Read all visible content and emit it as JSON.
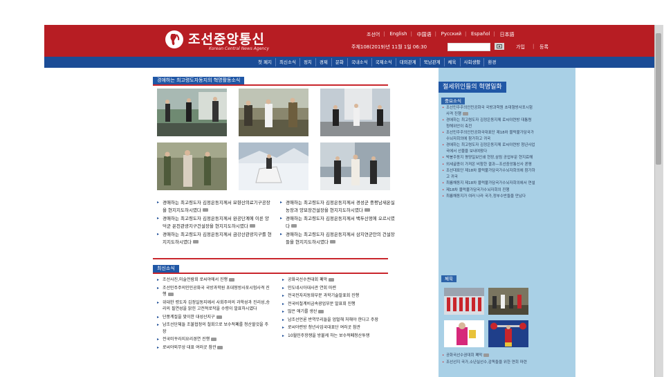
{
  "header": {
    "logo_text": "조선중앙통신",
    "logo_subtitle": "Korean Central News Agency",
    "languages": [
      "조선어",
      "English",
      "中国语",
      "Русский",
      "Español",
      "日本語"
    ],
    "date": "주체108(2019)년 11월 1일 06:30",
    "login_label": "가입",
    "register_label": "등록"
  },
  "nav": {
    "items": [
      "첫 페지",
      "최신소식",
      "정치",
      "경제",
      "문화",
      "국내소식",
      "국제소식",
      "대외관계",
      "북남관계",
      "체육",
      "사회생활",
      "환경"
    ]
  },
  "main": {
    "section_title": "경애하는 최고령도자동지의 혁명활동소식",
    "news_left": [
      "경애하는 최고령도자 김정은동지께서 묘향산의료기구공장을 현지지도하시였다",
      "경애하는 최고령도자 김정은동지께서 완공단계에 이른 양덕군 온천관광지구건설장을 현지지도하시였다",
      "경애하는 최고령도자 김정은동지께서 금강산관광지구를 현지지도하시였다"
    ],
    "news_right": [
      "경애하는 최고령도자 김정은동지께서 경성군 중평남새온실농장과 양묘장건설장을 현지지도하시였다",
      "경애하는 최고령도자 김정은동지께서 백두산정에 오르시였다",
      "경애하는 최고령도자 김정은동지께서 삼지연군안의 건설장들을 현지지도하시였다"
    ],
    "latest_title": "최신소식",
    "latest_left": [
      "조선사진,미술전람회 로씨야에서 진행",
      "조선민주주의인민공화국 국방과학원 초대형방사포시험사격 진행",
      "위대한 령도자 김정일동지께서 사회주의의 과학성과 진리성,승리의 필연성을 밝힌 고전적로작을 수령이 발표하시였다",
      "단풍계절을 맞이한 대성산지구",
      "남조선단체들 조불협정의 철회으로 보수적폐를 청산할것을 주장",
      "전국미꾸라지요리경연 진행",
      "로씨야외무상 대표 여러곳 참관"
    ],
    "latest_right": [
      "공화국선수권대회 폐막",
      "인도네시아대사관 연회 마련",
      "전국전자지동화부문 과학기술발표회 진행",
      "전국비철계비금속광업부문 발표회 진행",
      "많은 애기를 생산",
      "남조선언론 반역무리들을 엄벌해 처해야 한다고 주장",
      "로씨야련방 청년사업국대표단 여러곳 참관",
      "10월민주항쟁을 방불케 하는 보수적폐청산투쟁"
    ]
  },
  "sidebar": {
    "title": "절세위인들의 혁명일화",
    "important_title": "중요소식",
    "important_items": [
      "조선민주주의인민공화국 국방과학원 초대형방사포시험사격 진행",
      "경애하는 최고령도자 김정은동지께 로씨야련방 대통령 청해위안이 축전",
      "조선민주주의인민공화국대표단 제18차 블럭불가담국가수뇌자회의에 참가하고 귀국",
      "경애하는 최고령도자 김정은동지께 로씨야련방 청년사업국에서 선물을 보내여왔다",
      "박봉주동지 평양일보인쇄 현장,삼림 공업부문 현지료해",
      "외세굴종이 가져온 비참한 결과—조선중앙통신사 론평",
      "조선대표단 제18차 블럭불가담국가수뇌자회의에 참가하고 귀국",
      "최룡해동지 제18차 블럭불가담국가수뇌자회의에서 연설",
      "제18차 블럭불가담국가수뇌자회의 진행",
      "최룡해동지가 여러 나라 국가,정부수반들을 만났다"
    ],
    "sports_title": "체육",
    "sports_items": [
      "공화국선수권대회 폐막",
      "조선선지 국가,소년실선수,감독들을 위한 연회 마련"
    ]
  },
  "colors": {
    "header_red": "#b71d23",
    "nav_blue": "#1b4c96",
    "sidebar_blue": "#a9d0e6"
  }
}
